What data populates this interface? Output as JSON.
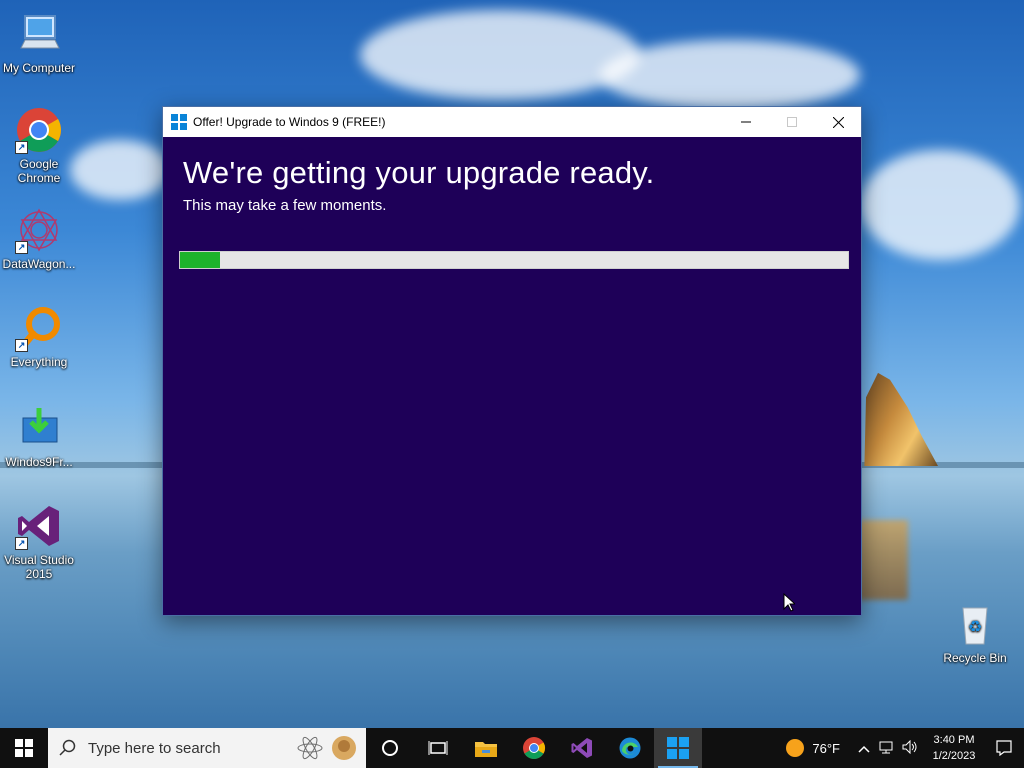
{
  "desktop": {
    "icons": [
      {
        "label": "My Computer"
      },
      {
        "label": "Google Chrome"
      },
      {
        "label": "DataWagon..."
      },
      {
        "label": "Everything"
      },
      {
        "label": "Windos9Fr..."
      },
      {
        "label": "Visual Studio 2015"
      },
      {
        "label": "Recycle Bin"
      }
    ]
  },
  "window": {
    "title": "Offer! Upgrade to Windos 9 (FREE!)",
    "heading": "We're getting your upgrade ready.",
    "subheading": "This may take a few moments.",
    "progress_percent": 6,
    "buttons": {
      "minimize_icon": "minimize-icon",
      "maximize_icon": "maximize-icon",
      "close_icon": "close-icon"
    }
  },
  "taskbar": {
    "search_placeholder": "Type here to search",
    "weather": "76°F",
    "time": "3:40 PM",
    "date": "1/2/2023"
  },
  "colors": {
    "window_bg": "#1e0058",
    "progress_fill": "#1db32b",
    "progress_track": "#e6e6e6",
    "taskbar_bg": "#101010"
  }
}
